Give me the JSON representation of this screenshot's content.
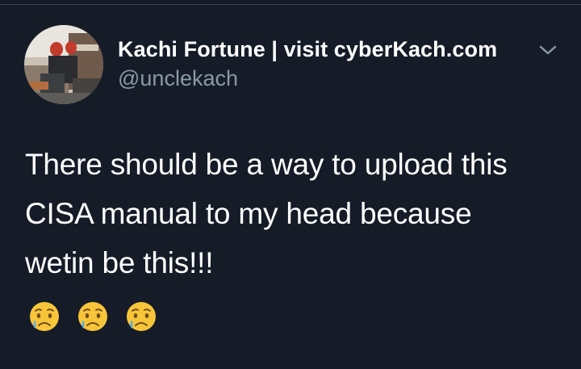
{
  "tweet": {
    "author": {
      "display_name": "Kachi Fortune | visit cyberKach.com",
      "handle": "@unclekach"
    },
    "text_lines": [
      "There should be a way to upload this",
      "CISA manual to my head because",
      "wetin be this!!!"
    ],
    "emojis": [
      "crying-face-emoji",
      "crying-face-emoji",
      "crying-face-emoji"
    ],
    "menu_icon": "chevron-down-icon"
  },
  "theme": {
    "background": "#151c28",
    "text_primary": "#ffffff",
    "text_secondary": "#8899a6",
    "divider": "#38444d"
  }
}
